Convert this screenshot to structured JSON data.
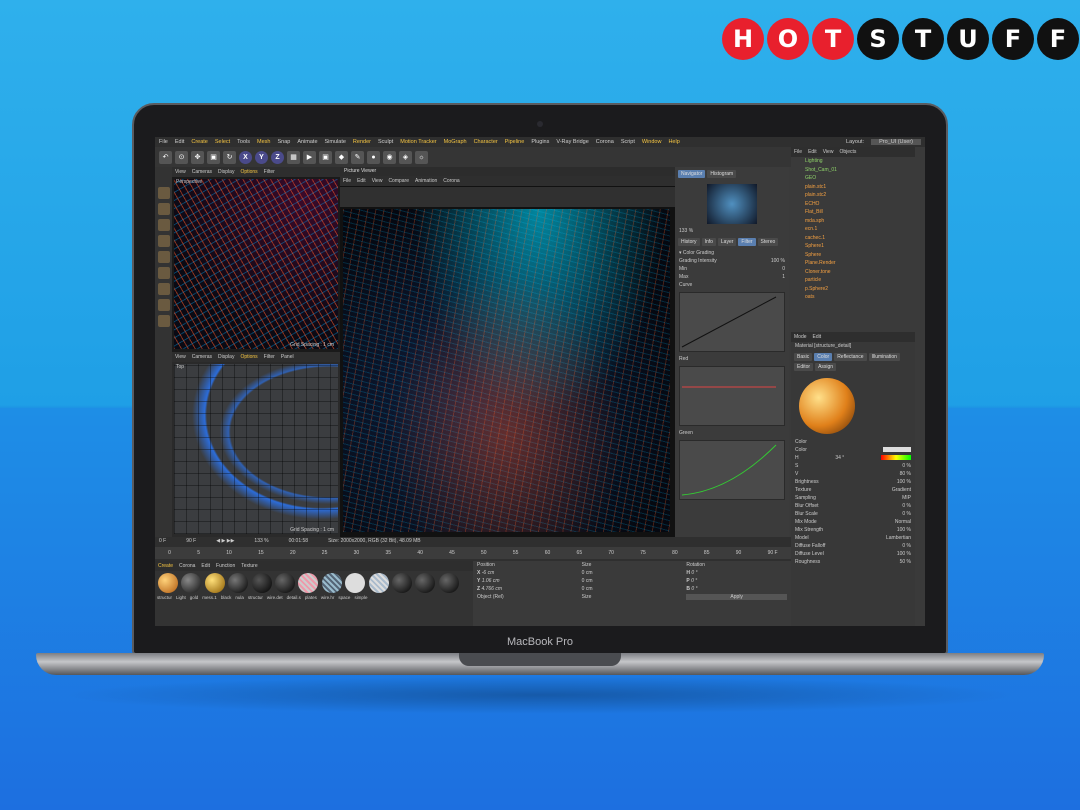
{
  "logo": {
    "letters": [
      "H",
      "O",
      "T",
      "S",
      "T",
      "U",
      "F",
      "F"
    ]
  },
  "device": {
    "brand_label": "MacBook Pro"
  },
  "app": {
    "menu": [
      "File",
      "Edit",
      "Create",
      "Select",
      "Tools",
      "Mesh",
      "Snap",
      "Animate",
      "Simulate",
      "Render",
      "Sculpt",
      "Motion Tracker",
      "MoGraph",
      "Character",
      "Pipeline",
      "Plugins",
      "V-Ray Bridge",
      "Corona",
      "Script",
      "Window",
      "Help"
    ],
    "layout_label": "Layout:",
    "layout_value": "Pro_UI (User)",
    "axis_buttons": [
      "X",
      "Y",
      "Z"
    ],
    "viewport_menu": [
      "View",
      "Cameras",
      "Display",
      "Options",
      "Filter",
      "Panel"
    ],
    "viewport_top_label": "Perspective",
    "viewport_bottom_label": "Top",
    "grid_spacing_1": "Grid Spacing : 1 cm",
    "grid_spacing_2": "Grid Spacing : 1 cm",
    "picture_viewer_title": "Picture Viewer",
    "pv_menu": [
      "File",
      "Edit",
      "View",
      "Compare",
      "Animation",
      "Corona"
    ],
    "nav_tabs": [
      "Navigator",
      "Histogram"
    ],
    "zoom": "133 %",
    "filter_tabs": [
      "History",
      "Info",
      "Layer",
      "Filter",
      "Stereo"
    ],
    "color_grading": "▾ Color Grading",
    "grading_intensity_label": "Grading Intensity",
    "grading_intensity_value": "100 %",
    "min_label": "Min",
    "min_value": "0",
    "max_label": "Max",
    "max_value": "1",
    "curve_labels": [
      "Curve",
      "Red",
      "Green"
    ],
    "objects_menu": [
      "File",
      "Edit",
      "View",
      "Objects"
    ],
    "objects": [
      "Lighting",
      "Shot_Cam_01",
      "GEO",
      "plain.stc1",
      "plain.stc2",
      "ECHO",
      "Flat_Bill",
      "mda.sph",
      "ecn.1",
      "cachec.1",
      "Sphere1",
      "Sphere",
      "Plane.Render",
      "Cloner.tone",
      "particle",
      "p.Sphere2",
      "oats"
    ],
    "attr_mode": [
      "Mode",
      "Edit"
    ],
    "material_name": "Material [structure_detail]",
    "material_tabs": [
      "Basic",
      "Color",
      "Reflectance",
      "Illumination",
      "Editor",
      "Assign"
    ],
    "color_section": "Color",
    "color_label": "Color",
    "h_label": "H",
    "h_value": "34 °",
    "s_label": "S",
    "s_value": "0 %",
    "v_label": "V",
    "v_value": "80 %",
    "brightness_label": "Brightness",
    "brightness_value": "100 %",
    "texture_label": "Texture",
    "texture_value": "Gradient",
    "sampling_label": "Sampling",
    "sampling_value": "MIP",
    "blur_offset_label": "Blur Offset",
    "blur_offset_value": "0 %",
    "blur_scale_label": "Blur Scale",
    "blur_scale_value": "0 %",
    "mix_mode_label": "Mix Mode",
    "mix_mode_value": "Normal",
    "mix_strength_label": "Mix Strength",
    "mix_strength_value": "100 %",
    "model_label": "Model",
    "model_value": "Lambertian",
    "diffuse_falloff_label": "Diffuse Falloff",
    "diffuse_falloff_value": "0 %",
    "diffuse_level_label": "Diffuse Level",
    "diffuse_level_value": "100 %",
    "roughness_label": "Roughness",
    "roughness_value": "50 %",
    "frame_start": "0 F",
    "frame_end": "90 F",
    "frame_end2": "90 F",
    "pv_zoom": "133 %",
    "pv_time": "00:01:58",
    "pv_size": "Size: 2000x2000, RGB (32 Bit), 48.09 MB",
    "ruler": [
      "0",
      "5",
      "10",
      "15",
      "20",
      "25",
      "30",
      "35",
      "40",
      "45",
      "50",
      "55",
      "60",
      "65",
      "70",
      "75",
      "80",
      "85",
      "90"
    ],
    "mat_menu": [
      "Create",
      "Corona",
      "Edit",
      "Function",
      "Texture"
    ],
    "materials": [
      "structur",
      "Light",
      "gold",
      "mess.1",
      "black",
      "nula",
      "structur",
      "wire.det",
      "detail.s",
      "plates",
      "wire.hr",
      "space",
      "simple"
    ],
    "coord_headers": [
      "Position",
      "Size",
      "Rotation"
    ],
    "coord_rows": [
      {
        "axis": "X",
        "pos": "-6 cm",
        "size": "0 cm",
        "rot_axis": "H",
        "rot": "0 °"
      },
      {
        "axis": "Y",
        "pos": "1.06 cm",
        "size": "0 cm",
        "rot_axis": "P",
        "rot": "0 °"
      },
      {
        "axis": "Z",
        "pos": "4.766 cm",
        "size": "0 cm",
        "rot_axis": "B",
        "rot": "0 °"
      }
    ],
    "coord_mode": "Object (Rel)",
    "coord_size_mode": "Size",
    "apply_label": "Apply"
  },
  "colors": {
    "accent": "#f5c542",
    "logo_red": "#e8202d",
    "logo_black": "#111111"
  }
}
